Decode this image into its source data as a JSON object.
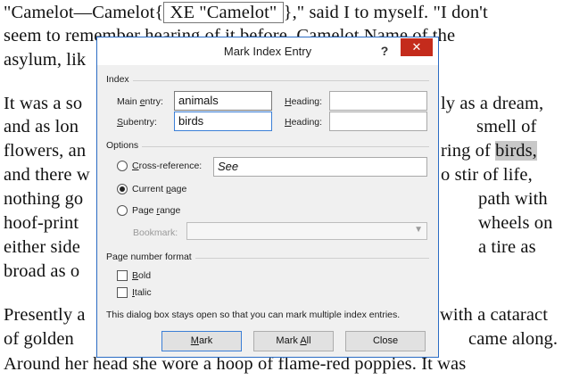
{
  "document": {
    "lines": [
      "\"Camelot—Camelot{ XE \"Camelot\" },\" said I to myself. \"I don't",
      "seem to remember hearing of it before. Camelot Name of the",
      "asylum, lik",
      "It was a so",
      "and as lon",
      "flowers, an",
      "and there w",
      "nothing go",
      "hoof-print",
      "either side",
      "broad as o",
      "Presently a",
      "of golden",
      "Around her head she wore a hoop of flame-red poppies. It was"
    ],
    "right_fragments": [
      "ly as a dream,",
      "smell of",
      "ring of",
      "birds,",
      "o stir of life,",
      "path with",
      "wheels on",
      "a tire as",
      "with a cataract",
      "came along."
    ],
    "line1_parts": {
      "before": "\"Camelot—Camelot{",
      "field": " XE \"Camelot\" ",
      "after": "},\" said I to myself. \"I don't"
    }
  },
  "dialog": {
    "title": "Mark Index Entry",
    "help_label": "?",
    "close_label": "✕",
    "index_section": "Index",
    "main_entry_label_pre": "Main ",
    "main_entry_label_u": "e",
    "main_entry_label_post": "ntry:",
    "main_entry_value": "animals",
    "subentry_label_u": "S",
    "subentry_label_post": "ubentry:",
    "subentry_value": "birds",
    "heading_label_u": "H",
    "heading_label_post": "eading:",
    "heading1_value": "",
    "heading2_value": "",
    "options_section": "Options",
    "cross_ref_label_u": "C",
    "cross_ref_label_post": "ross-reference:",
    "cross_ref_value": "See",
    "current_page_label_pre": "Current ",
    "current_page_label_u": "p",
    "current_page_label_post": "age",
    "page_range_label_pre": "Page ",
    "page_range_label_u": "r",
    "page_range_label_post": "ange",
    "bookmark_label": "Bookmark:",
    "page_number_section": "Page number format",
    "bold_label_u": "B",
    "bold_label_post": "old",
    "italic_label_u": "I",
    "italic_label_post": "talic",
    "note": "This dialog box stays open so that you can mark multiple index entries.",
    "mark_button_u": "M",
    "mark_button_post": "ark",
    "mark_all_pre": "Mark ",
    "mark_all_u": "A",
    "mark_all_post": "ll",
    "close_button": "Close",
    "selected_option": "current_page",
    "bold_checked": false,
    "italic_checked": false
  }
}
